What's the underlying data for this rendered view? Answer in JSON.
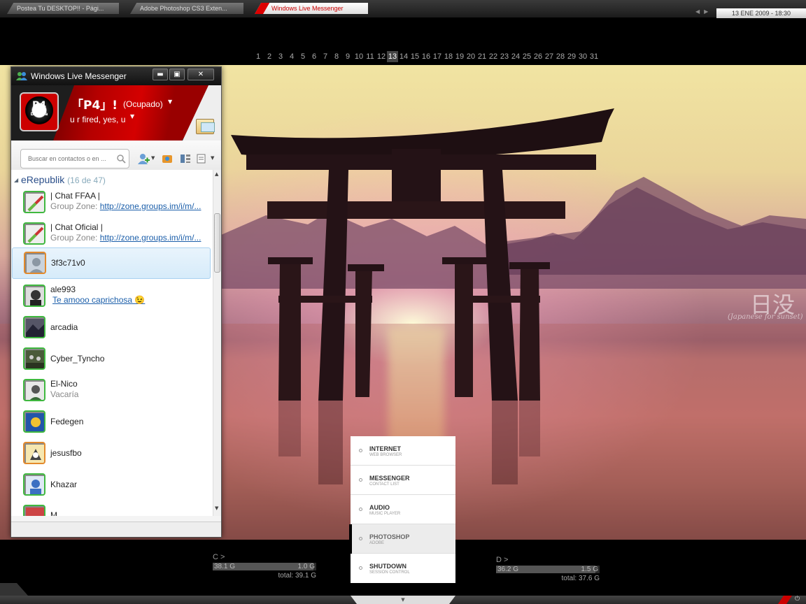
{
  "taskbar": {
    "tabs": [
      {
        "label": "Postea Tu DESKTOP!! - Pági..."
      },
      {
        "label": "Adobe Photoshop CS3 Exten..."
      },
      {
        "label": "Windows Live Messenger"
      }
    ],
    "clock": "13 ENE 2009 - 18:30"
  },
  "calendar": {
    "days": [
      "1",
      "2",
      "3",
      "4",
      "5",
      "6",
      "7",
      "8",
      "9",
      "10",
      "11",
      "12",
      "13",
      "14",
      "15",
      "16",
      "17",
      "18",
      "19",
      "20",
      "21",
      "22",
      "23",
      "24",
      "25",
      "26",
      "27",
      "28",
      "29",
      "30",
      "31"
    ],
    "today": "13"
  },
  "wallpaper": {
    "kanji": "日没",
    "caption": "(Japanese for sunset)"
  },
  "launcher": {
    "items": [
      {
        "title": "INTERNET",
        "sub": "WEB BROWSER"
      },
      {
        "title": "MESSENGER",
        "sub": "CONTACT LIST"
      },
      {
        "title": "AUDIO",
        "sub": "MUSIC PLAYER"
      },
      {
        "title": "PHOTOSHOP",
        "sub": "ADOBE"
      },
      {
        "title": "SHUTDOWN",
        "sub": "SESSION CONTROL"
      }
    ],
    "selected_index": 3
  },
  "drives": [
    {
      "label": "C >",
      "used": "38.1 G",
      "free": "1.0 G",
      "total": "total: 39.1 G",
      "used_fraction": 0.97
    },
    {
      "label": "D >",
      "used": "36.2 G",
      "free": "1.5 G",
      "total": "total: 37.6 G",
      "used_fraction": 0.96
    }
  ],
  "messenger": {
    "title": "Windows Live Messenger",
    "buttons": {
      "minimize": "▬",
      "maximize": "▣",
      "close": "✕"
    },
    "avatar_text": "P4",
    "avatar_subtext": "DeZeTa",
    "display_name": "「P4」!",
    "status": "(Ocupado)",
    "personal_message": "u r fired, yes, u",
    "search_placeholder": "Buscar en contactos o en ...",
    "group": {
      "name": "eRepublik",
      "count": "(16 de 47)"
    },
    "contacts": [
      {
        "name": "| Chat FFAA |",
        "sub_prefix": "Group Zone: ",
        "sub_link": "http://zone.groups.im/i/m/..."
      },
      {
        "name": "| Chat Oficial |",
        "sub_prefix": "Group Zone: ",
        "sub_link": "http://zone.groups.im/i/m/..."
      },
      {
        "name": "3f3c71v0"
      },
      {
        "name": "ale993",
        "sub_link": "Te amooo caprichosa 😉"
      },
      {
        "name": "arcadia"
      },
      {
        "name": "Cyber_Tyncho"
      },
      {
        "name": "El-Nico",
        "sub": "Vacaría"
      },
      {
        "name": "Fedegen"
      },
      {
        "name": "jesusfbo"
      },
      {
        "name": "Khazar"
      },
      {
        "name": "M..."
      }
    ]
  },
  "colors": {
    "accent_red": "#c00000",
    "online_green": "#3fb83f",
    "link_blue": "#1c5faa"
  }
}
